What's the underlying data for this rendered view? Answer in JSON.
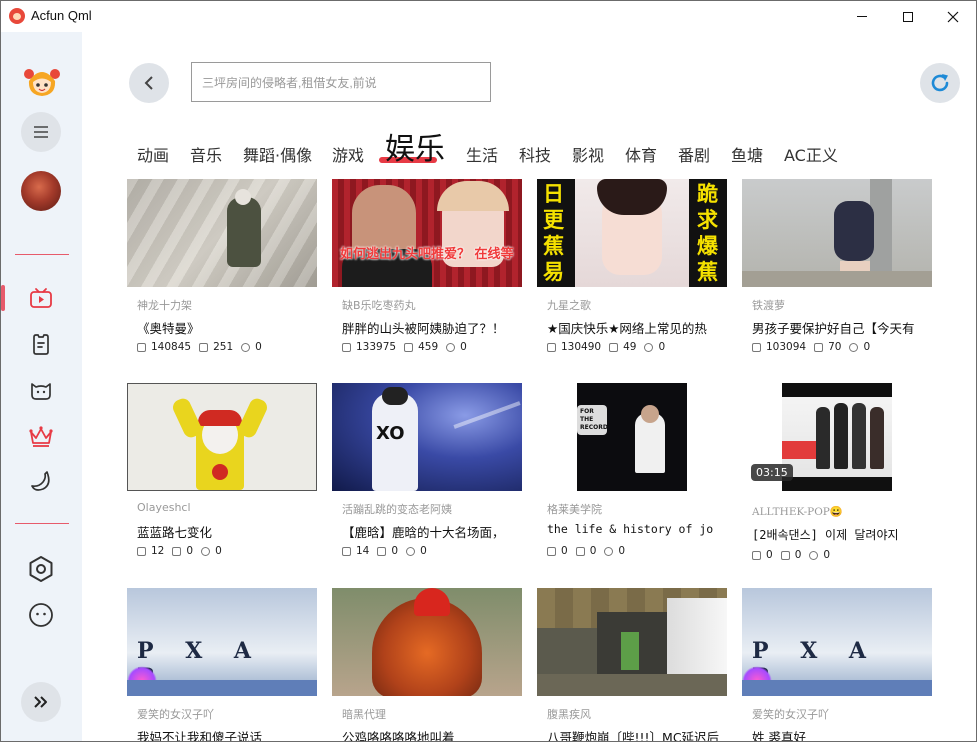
{
  "window": {
    "title": "Acfun Qml"
  },
  "search": {
    "placeholder": "三坪房间的侵略者,租借女友,前说"
  },
  "tabs": [
    {
      "label": "动画"
    },
    {
      "label": "音乐"
    },
    {
      "label": "舞蹈·偶像"
    },
    {
      "label": "游戏"
    },
    {
      "label": "娱乐",
      "active": true
    },
    {
      "label": "生活"
    },
    {
      "label": "科技"
    },
    {
      "label": "影视"
    },
    {
      "label": "体育"
    },
    {
      "label": "番剧"
    },
    {
      "label": "鱼塘"
    },
    {
      "label": "AC正义"
    }
  ],
  "videos": [
    {
      "uploader": "神龙十力架",
      "title": "《奥特曼》",
      "views": "140845",
      "comments": "251",
      "bananas": "0"
    },
    {
      "uploader": "缺B乐吃枣药丸",
      "title": "胖胖的山头被阿姨胁迫了？！",
      "views": "133975",
      "comments": "459",
      "bananas": "0",
      "thumb_text": "如何逃出九头吧推爱？ 在线等"
    },
    {
      "uploader": "九星之歌",
      "title": "★国庆快乐★网络上常见的热",
      "views": "130490",
      "comments": "49",
      "bananas": "0",
      "thumb_left": "日更蕉易",
      "thumb_right": "跪求爆蕉"
    },
    {
      "uploader": "铁渡萝",
      "title": "男孩子要保护好自己【今天有",
      "views": "103094",
      "comments": "70",
      "bananas": "0"
    },
    {
      "uploader": "Olayeshcl",
      "title": "蓝蓝路七变化",
      "views": "12",
      "comments": "0",
      "bananas": "0"
    },
    {
      "uploader": "活蹦乱跳的变态老阿姨",
      "title": "【鹿晗】鹿晗的十大名场面，",
      "views": "14",
      "comments": "0",
      "bananas": "0"
    },
    {
      "uploader": "格莱美学院",
      "title": "the life & history of jo",
      "views": "0",
      "comments": "0",
      "bananas": "0",
      "thumb_text": "FOR THE RECORD"
    },
    {
      "uploader": "ALLTHEK-POP😀",
      "title": "[2배속댄스] 이제 달려야지",
      "views": "0",
      "comments": "0",
      "bananas": "0",
      "duration": "03:15"
    },
    {
      "uploader": "爱笑的女汉子吖",
      "title": "我妈不让我和傻子说话",
      "thumb_text": "P X A R"
    },
    {
      "uploader": "暗黑代理",
      "title": "公鸡咯咯咯咯地叫着"
    },
    {
      "uploader": "腹黑疾风",
      "title": "八哥鞭炮崩〔哔!!!〕MC延迟后"
    },
    {
      "uploader": "爱笑的女汉子吖",
      "title": "姓 裘真好",
      "thumb_text": "P X A R"
    }
  ],
  "icons": {
    "back": "chevron-left-icon",
    "refresh": "refresh-icon",
    "menu": "menu-icon",
    "tv": "tv-icon",
    "clipboard": "clipboard-icon",
    "cat": "cat-icon",
    "crown": "crown-icon",
    "banana": "banana-icon",
    "hexagon": "hexagon-settings-icon",
    "face": "face-icon",
    "expand": "double-chevron-right-icon"
  },
  "colors": {
    "accent": "#e75a6b",
    "refresh": "#1e8ad6",
    "sidebar_bg": "#eef3f9"
  }
}
